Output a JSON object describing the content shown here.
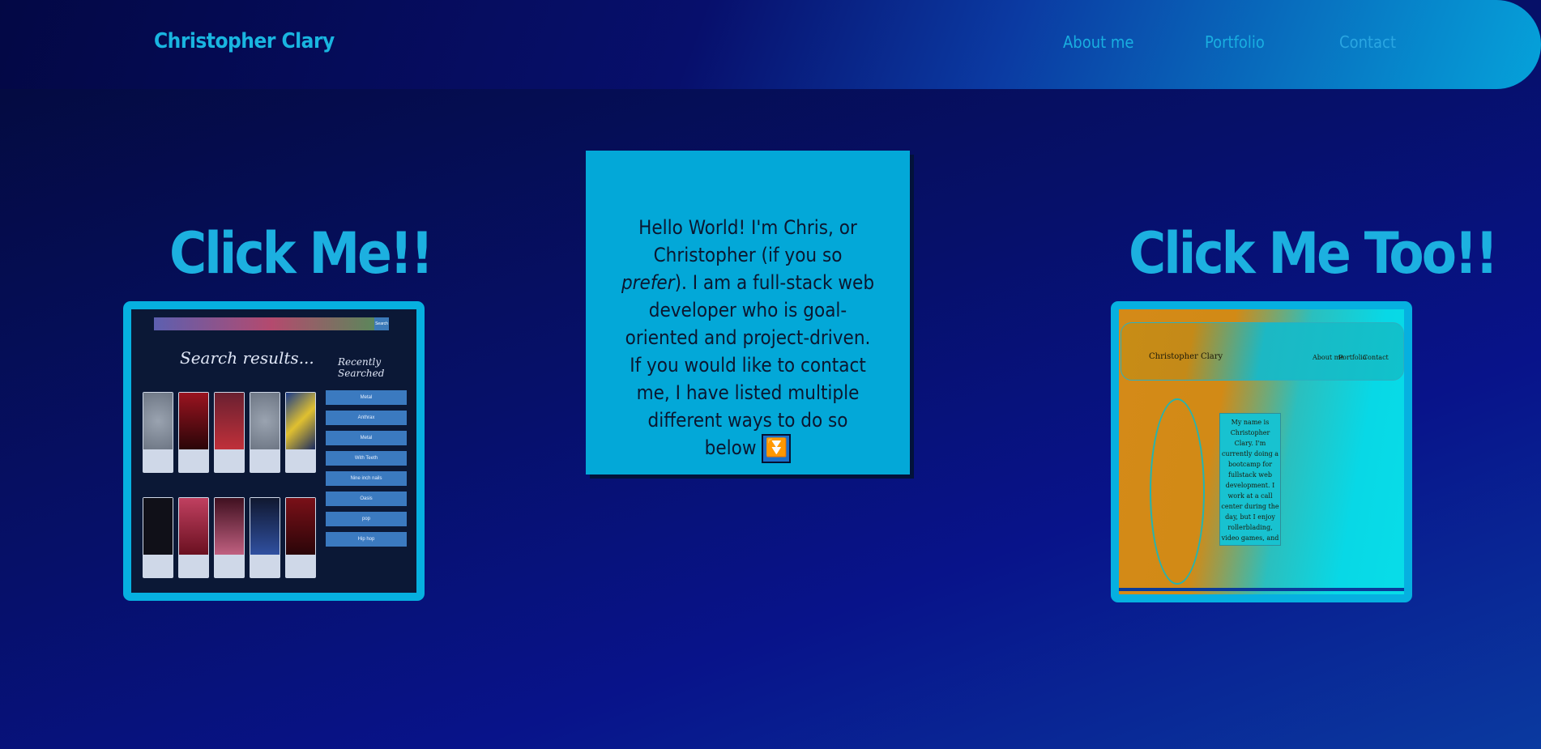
{
  "header": {
    "brand": "Christopher Clary",
    "nav": [
      "About me",
      "Portfolio",
      "Contact"
    ]
  },
  "projects": [
    {
      "title": "Click Me!!",
      "thumbnail": {
        "search_label": "Search",
        "results_title": "Search results...",
        "recent_title": "Recently Searched",
        "recent_items": [
          "Metal",
          "Anthrax",
          "Metal",
          "With Teeth",
          "Nine inch nails",
          "Oasis",
          "pop",
          "Hip hop"
        ]
      }
    },
    {
      "title": "Click Me Too!!",
      "thumbnail": {
        "brand": "Christopher Clary",
        "nav": [
          "About me",
          "Portfolio",
          "Contact"
        ],
        "paragraph": "My name is Christopher Clary. I'm currently doing a bootcamp for fullstack web development. I work at a call center during the day, but I enjoy rollerblading, video games, and enjoying nature in my freetime."
      }
    }
  ],
  "intro": {
    "text_before": "Hello World! I'm Chris, or Christopher (if you so ",
    "emphasis": "prefer",
    "text_after": "). I am a full-stack web developer who is goal-oriented and project-driven. If you would like to contact me, I have listed multiple different ways to do so below",
    "button_icon": "⏬"
  }
}
